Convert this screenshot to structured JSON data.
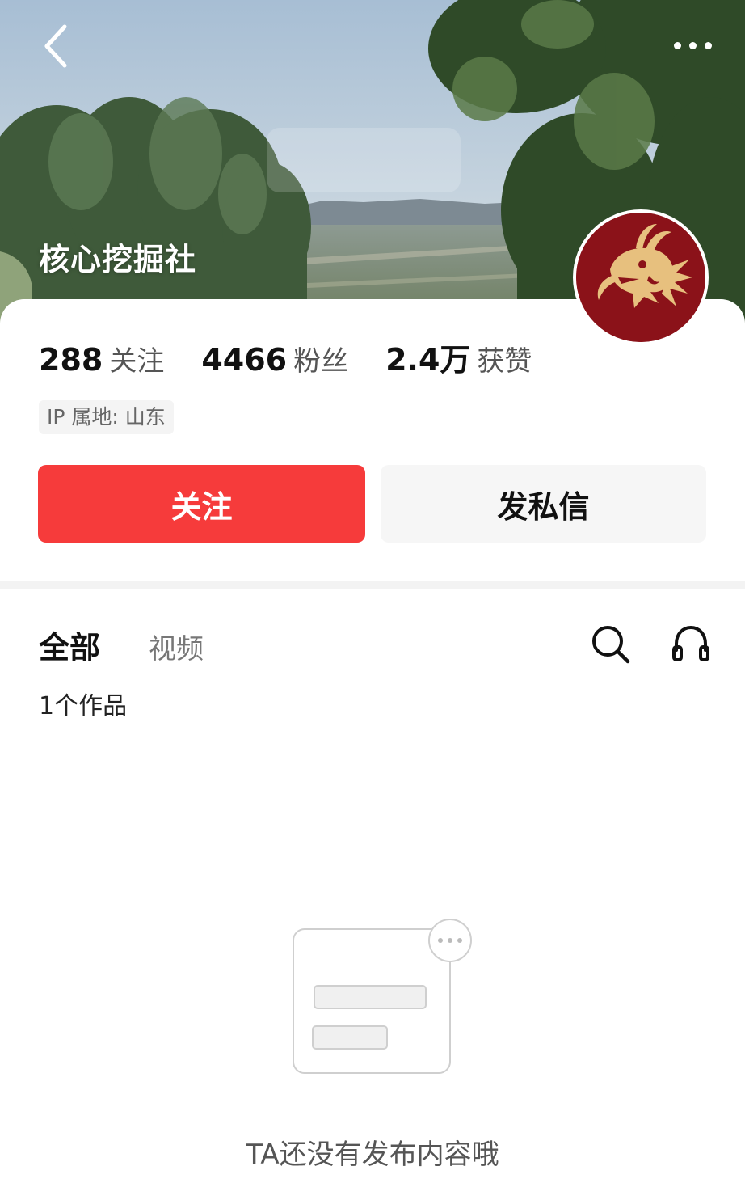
{
  "header": {
    "back_icon": "chevron-left-icon",
    "more_icon": "more-dots-icon",
    "profile_name": "核心挖掘社"
  },
  "stats": [
    {
      "value": "288",
      "label": "关注"
    },
    {
      "value": "4466",
      "label": "粉丝"
    },
    {
      "value": "2.4万",
      "label": "获赞"
    }
  ],
  "ip_location": "IP 属地: 山东",
  "actions": {
    "follow": "关注",
    "message": "发私信"
  },
  "tabs": {
    "all": "全部",
    "video": "视频"
  },
  "toolbar_icons": [
    "search-icon",
    "headphone-icon"
  ],
  "works_count": "1个作品",
  "empty_state": {
    "text": "TA还没有发布内容哦"
  },
  "colors": {
    "accent": "#f63b3b",
    "avatar_bg": "#8b1219",
    "dragon_gold": "#e7c07e"
  }
}
